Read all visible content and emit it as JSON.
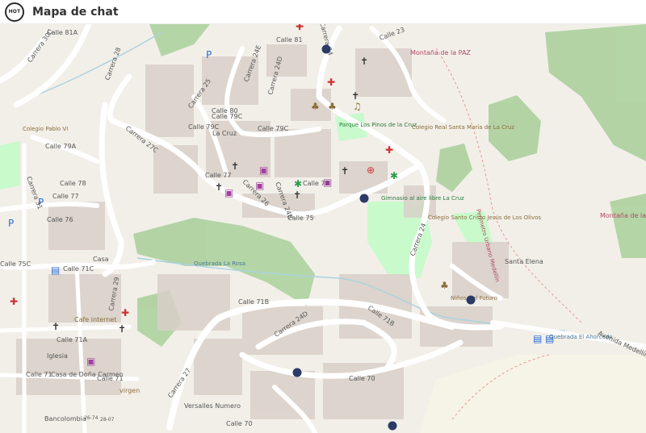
{
  "header": {
    "logo_text": "HOT",
    "title": "Mapa de chat"
  },
  "map": {
    "colors": {
      "background": "#f2efe9",
      "park": "#c8facc",
      "wood": "#add19e",
      "road": "#ffffff",
      "building": "#d9d0c9",
      "marker": "#2b3a67"
    },
    "labels": {
      "calle81a": "Calle 81A",
      "carrera30c": "Carrera 30C",
      "calle81": "Calle 81",
      "carrera28": "Carrera 28",
      "carrera25": "Carrera 25",
      "carrera24": "Carrera 24",
      "carrera24d": "Carrera 24D",
      "carrera24e": "Carrera 24E",
      "calle80": "Calle 80",
      "calle79c": "Calle 79C",
      "calle79c_b": "Calle 79C",
      "calle79c_c": "Calle 79C",
      "carrera27c": "Carrera 27C",
      "calle79a": "Calle 79A",
      "calle78": "Calle 78",
      "calle77": "Calle 77",
      "calle77_b": "Calle 77",
      "calle77_c": "Calle 77",
      "calle76": "Calle 76",
      "calle75": "Calle 75",
      "calle75c": "Calle 75C",
      "calle71c": "Calle 71C",
      "calle71b": "Calle 71B",
      "calle71b_b": "Calle 71B",
      "calle71a": "Calle 71A",
      "calle71": "Calle 71",
      "calle71_b": "Calle 71",
      "calle70": "Calle 70",
      "calle70_b": "Calle 70",
      "carrera29": "Carrera 29",
      "carrera31": "Carrera 31",
      "carrera24d_b": "Carrera 24D",
      "carrera24b": "Carrera 24B",
      "carrera27": "Carrera 27",
      "carrera26": "Carrera 26",
      "carrera24_b": "Carrera 24",
      "calle23": "Calle 23",
      "montana": "Montaña de la PAZ",
      "montana2": "Montaña de la PAZ",
      "parque": "Parque Los Pinos de la Cruz",
      "gimnasio": "Gimnasio al aire libre La Cruz",
      "colegio_pablo": "Colegio Pablo VI",
      "colegio_santa": "Colegio Real Santa María de La Cruz",
      "colegio_jesus": "Colegio Santo Cristo Jesús de Los Olivos",
      "ninos": "Niños Del Futuro",
      "santa_elena": "Santa Elena",
      "perimetro": "Perímetro Urbano Medellín",
      "quebrada": "Quebrada La Rosa",
      "quebrada2": "Quebrada El Ahorcado",
      "avenida": "Avenida Medellín",
      "cafe": "Cafe internet",
      "iglesia": "Iglesia",
      "casa_dona": "Casa de Doña Carmen",
      "virgen": "virgen",
      "bancolombia": "Bancolombia",
      "versalles": "Versalles Numero",
      "casa": "Casa",
      "la_cruz": "La Cruz",
      "nodo1": "26-74",
      "nodo2": "28-07"
    },
    "markers": [
      "chat-marker-1",
      "chat-marker-2",
      "chat-marker-3",
      "chat-marker-4",
      "chat-marker-5"
    ]
  }
}
